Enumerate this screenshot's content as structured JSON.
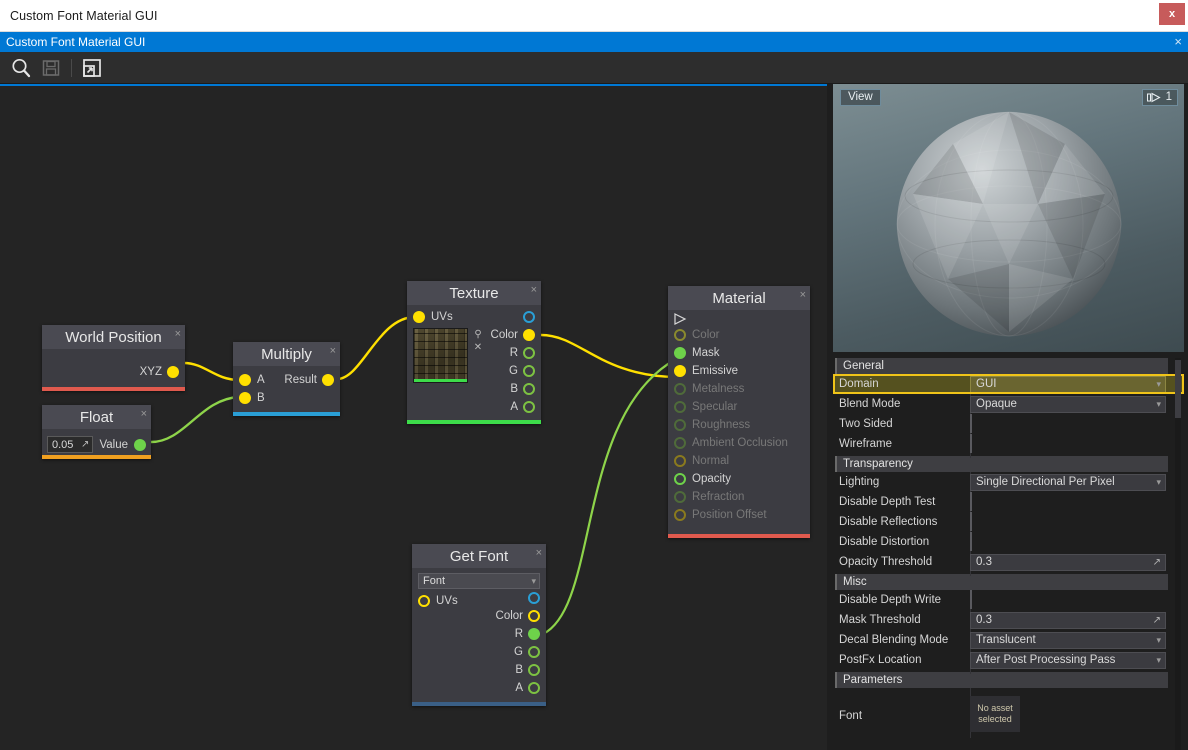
{
  "window": {
    "title": "Custom Font Material GUI",
    "close_label": "x"
  },
  "document_tab": {
    "label": "Custom Font Material GUI",
    "close_label": "×"
  },
  "toolbar": {
    "items": [
      {
        "name": "search-icon",
        "label": "Search",
        "enabled": true
      },
      {
        "name": "save-icon",
        "label": "Save",
        "enabled": false
      },
      {
        "name": "fit-to-window-icon",
        "label": "Fit To Window",
        "enabled": true
      }
    ]
  },
  "graph": {
    "nodes": [
      {
        "id": "world-position",
        "title": "World Position",
        "close_label": "×",
        "accent": "#e05a4e",
        "outputs": [
          {
            "label": "XYZ",
            "color": "#ffe000",
            "filled": true
          }
        ],
        "inputs": []
      },
      {
        "id": "float",
        "title": "Float",
        "close_label": "×",
        "accent": "#f0a020",
        "value": "0.05",
        "outputs": [
          {
            "label": "Value",
            "color": "#6ed24a",
            "filled": true
          }
        ]
      },
      {
        "id": "multiply",
        "title": "Multiply",
        "close_label": "×",
        "accent": "#2a9fd6",
        "inputs": [
          {
            "label": "A",
            "color": "#ffe000",
            "filled": true
          },
          {
            "label": "B",
            "color": "#ffe000",
            "filled": true
          }
        ],
        "outputs": [
          {
            "label": "Result",
            "color": "#ffe000",
            "filled": true
          }
        ]
      },
      {
        "id": "texture",
        "title": "Texture",
        "close_label": "×",
        "accent": "#3ddc4a",
        "inputs": [
          {
            "label": "UVs",
            "color": "#ffe000",
            "filled": true
          }
        ],
        "outputs": [
          {
            "label": "",
            "color": "#2a9fd6",
            "filled": false
          },
          {
            "label": "Color",
            "color": "#ffe000",
            "filled": true
          },
          {
            "label": "R",
            "color": "#7dc242",
            "filled": false
          },
          {
            "label": "G",
            "color": "#7dc242",
            "filled": false
          },
          {
            "label": "B",
            "color": "#7dc242",
            "filled": false
          },
          {
            "label": "A",
            "color": "#7dc242",
            "filled": false
          }
        ],
        "thumb_tools": [
          "⚲",
          "✕"
        ]
      },
      {
        "id": "get-font",
        "title": "Get Font",
        "close_label": "×",
        "accent": "#3a5f86",
        "combo_value": "Font",
        "inputs": [
          {
            "label": "UVs",
            "color": "#ffe000",
            "filled": false
          }
        ],
        "outputs": [
          {
            "label": "",
            "color": "#2a9fd6",
            "filled": false
          },
          {
            "label": "Color",
            "color": "#ffe000",
            "filled": false
          },
          {
            "label": "R",
            "color": "#6ed24a",
            "filled": true
          },
          {
            "label": "G",
            "color": "#7dc242",
            "filled": false
          },
          {
            "label": "B",
            "color": "#7dc242",
            "filled": false
          },
          {
            "label": "A",
            "color": "#7dc242",
            "filled": false
          }
        ]
      },
      {
        "id": "material",
        "title": "Material",
        "close_label": "×",
        "accent": "#e05a4e",
        "inputs": [
          {
            "label": "Color",
            "color": "#8a8a2e",
            "filled": false,
            "dim": true
          },
          {
            "label": "Mask",
            "color": "#6ed24a",
            "filled": true,
            "dim": false
          },
          {
            "label": "Emissive",
            "color": "#ffe000",
            "filled": true,
            "dim": false
          },
          {
            "label": "Metalness",
            "color": "#4f6b3a",
            "filled": false,
            "dim": true
          },
          {
            "label": "Specular",
            "color": "#4f6b3a",
            "filled": false,
            "dim": true
          },
          {
            "label": "Roughness",
            "color": "#4f6b3a",
            "filled": false,
            "dim": true
          },
          {
            "label": "Ambient Occlusion",
            "color": "#4f6b3a",
            "filled": false,
            "dim": true
          },
          {
            "label": "Normal",
            "color": "#8a7a1e",
            "filled": false,
            "dim": true
          },
          {
            "label": "Opacity",
            "color": "#6ed24a",
            "filled": false,
            "dim": false
          },
          {
            "label": "Refraction",
            "color": "#4f6b3a",
            "filled": false,
            "dim": true
          },
          {
            "label": "Position Offset",
            "color": "#8a7a1e",
            "filled": false,
            "dim": true
          }
        ]
      }
    ],
    "connection_colors": {
      "yellow": "#ffe000",
      "green": "#8ed44a"
    }
  },
  "viewport": {
    "view_button": "View",
    "stat_value": "1",
    "stat_icon": "draw-calls-icon"
  },
  "properties": {
    "groups": [
      {
        "title": "General",
        "rows": [
          {
            "label": "Domain",
            "type": "combo",
            "value": "GUI",
            "highlighted": true
          },
          {
            "label": "Blend Mode",
            "type": "combo",
            "value": "Opaque"
          },
          {
            "label": "Two Sided",
            "type": "checkbox",
            "checked": false
          },
          {
            "label": "Wireframe",
            "type": "checkbox",
            "checked": false
          }
        ]
      },
      {
        "title": "Transparency",
        "rows": [
          {
            "label": "Lighting",
            "type": "combo",
            "value": "Single Directional Per Pixel"
          },
          {
            "label": "Disable Depth Test",
            "type": "checkbox",
            "checked": false
          },
          {
            "label": "Disable Reflections",
            "type": "checkbox",
            "checked": false
          },
          {
            "label": "Disable Distortion",
            "type": "checkbox",
            "checked": false
          },
          {
            "label": "Opacity Threshold",
            "type": "text",
            "value": "0.3"
          }
        ]
      },
      {
        "title": "Misc",
        "rows": [
          {
            "label": "Disable Depth Write",
            "type": "checkbox",
            "checked": false
          },
          {
            "label": "Mask Threshold",
            "type": "text",
            "value": "0.3"
          },
          {
            "label": "Decal Blending Mode",
            "type": "combo",
            "value": "Translucent"
          },
          {
            "label": "PostFx Location",
            "type": "combo",
            "value": "After Post Processing Pass"
          }
        ]
      },
      {
        "title": "Parameters",
        "rows": [
          {
            "label": "Font",
            "type": "asset",
            "value": "No asset selected"
          }
        ]
      }
    ]
  }
}
